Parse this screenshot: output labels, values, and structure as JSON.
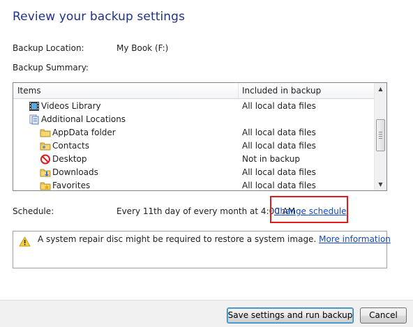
{
  "title": "Review your backup settings",
  "backup_location": {
    "label": "Backup Location:",
    "value": "My Book (F:)"
  },
  "backup_summary_label": "Backup Summary:",
  "list": {
    "columns": [
      "Items",
      "Included in backup"
    ],
    "rows": [
      {
        "name": "Videos Library",
        "included": "All local data files",
        "icon": "videos-library-icon",
        "indent": 1
      },
      {
        "name": "Additional Locations",
        "included": "",
        "icon": "additional-locations-icon",
        "indent": 1
      },
      {
        "name": "AppData folder",
        "included": "All local data files",
        "icon": "folder-icon",
        "indent": 2
      },
      {
        "name": "Contacts",
        "included": "All local data files",
        "icon": "contacts-folder-icon",
        "indent": 2
      },
      {
        "name": "Desktop",
        "included": "Not in backup",
        "icon": "not-allowed-icon",
        "indent": 2
      },
      {
        "name": "Downloads",
        "included": "All local data files",
        "icon": "downloads-folder-icon",
        "indent": 2
      },
      {
        "name": "Favorites",
        "included": "All local data files",
        "icon": "favorites-folder-icon",
        "indent": 2
      }
    ]
  },
  "schedule": {
    "label": "Schedule:",
    "value": "Every 11th day of every month at 4:00 AM",
    "change_link": "Change schedule"
  },
  "warning": {
    "text": "A system repair disc might be required to restore a system image.",
    "link": "More information",
    "icon": "warning-icon"
  },
  "buttons": {
    "save": "Save settings and run backup",
    "cancel": "Cancel"
  },
  "colors": {
    "title": "#1e3287",
    "link": "#0f4ac1",
    "highlight": "#e21b1b"
  }
}
